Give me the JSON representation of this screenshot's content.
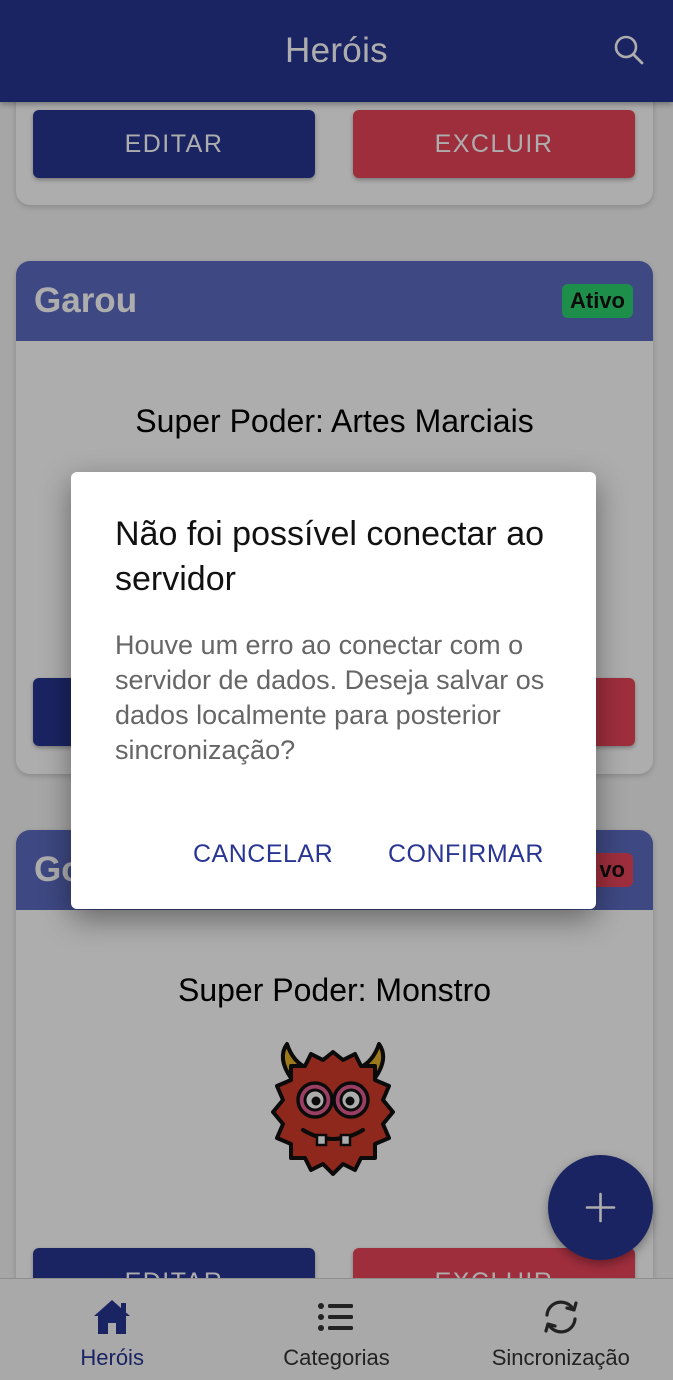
{
  "header": {
    "title": "Heróis",
    "search_icon": "search-icon"
  },
  "cards": [
    {
      "edit_label": "EDITAR",
      "delete_label": "EXCLUIR"
    },
    {
      "name": "Garou",
      "status": "Ativo",
      "power": "Super Poder: Artes Marciais"
    },
    {
      "name": "Go",
      "status": "vo",
      "power": "Super Poder: Monstro",
      "edit_label": "EDITAR",
      "delete_label": "EXCLUIR"
    }
  ],
  "dialog": {
    "title": "Não foi possível conectar ao servidor",
    "message": "Houve um erro ao conectar com o servidor de dados. Deseja salvar os dados localmente para posterior sincronização?",
    "cancel": "CANCELAR",
    "confirm": "CONFIRMAR"
  },
  "tabs": [
    {
      "label": "Heróis",
      "icon": "home-icon",
      "active": true
    },
    {
      "label": "Categorias",
      "icon": "list-icon",
      "active": false
    },
    {
      "label": "Sincronização",
      "icon": "sync-icon",
      "active": false
    }
  ],
  "fab": {
    "icon": "plus-icon"
  },
  "colors": {
    "primary": "#283593",
    "danger": "#eb445a",
    "success": "#2dd36f",
    "card_header": "#5c6bc0"
  }
}
